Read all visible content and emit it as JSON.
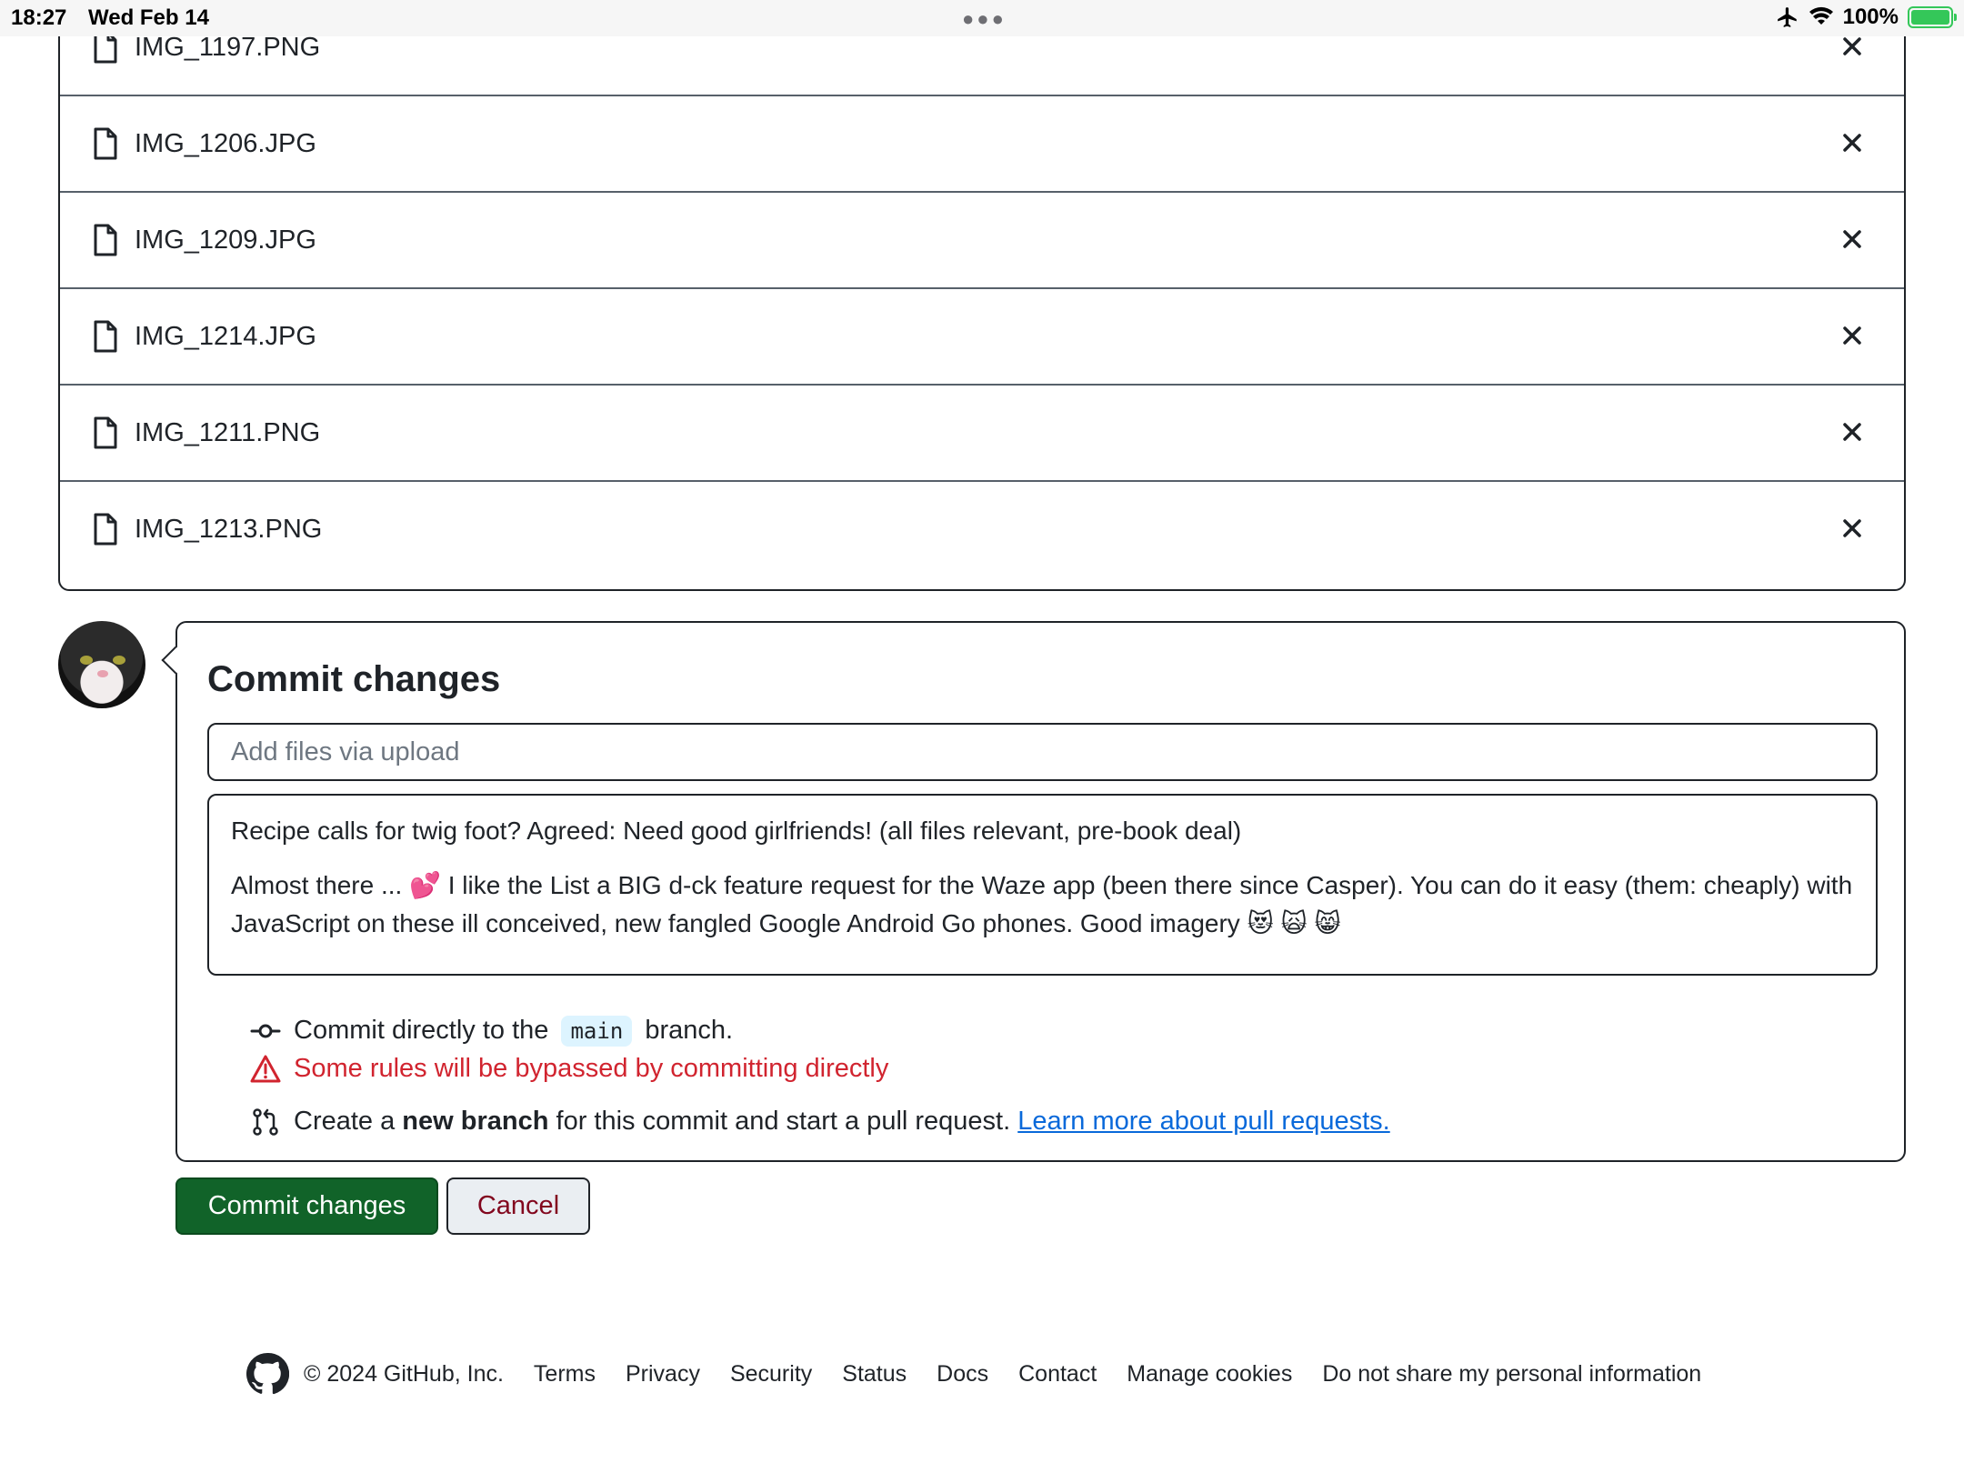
{
  "status_bar": {
    "time": "18:27",
    "date": "Wed Feb 14",
    "battery": "100%"
  },
  "files": [
    {
      "name": "IMG_1197.PNG"
    },
    {
      "name": "IMG_1206.JPG"
    },
    {
      "name": "IMG_1209.JPG"
    },
    {
      "name": "IMG_1214.JPG"
    },
    {
      "name": "IMG_1211.PNG"
    },
    {
      "name": "IMG_1213.PNG"
    }
  ],
  "commit": {
    "title": "Commit changes",
    "summary_placeholder": "Add files via upload",
    "description_line1": "Recipe calls for twig foot? Agreed: Need good girlfriends! (all files relevant, pre-book deal)",
    "description_line2": "Almost there ... 💕 I like the List a BIG d-ck feature request for the Waze app (been there since Casper). You can do it easy (them: cheaply) with JavaScript on these ill conceived, new fangled Google Android Go phones. Good imagery 😻 🙀 😸",
    "direct_prefix": "Commit directly to the",
    "branch": "main",
    "direct_suffix": "branch.",
    "warning": "Some rules will be bypassed by committing directly",
    "newbranch_prefix": "Create a",
    "newbranch_bold": "new branch",
    "newbranch_suffix": "for this commit and start a pull request.",
    "learn_more": "Learn more about pull requests."
  },
  "buttons": {
    "commit": "Commit changes",
    "cancel": "Cancel"
  },
  "footer": {
    "copyright": "© 2024 GitHub, Inc.",
    "links": [
      "Terms",
      "Privacy",
      "Security",
      "Status",
      "Docs",
      "Contact",
      "Manage cookies",
      "Do not share my personal information"
    ]
  },
  "colors": {
    "primary_button": "#116329",
    "warning": "#d1242f",
    "link": "#0969da"
  }
}
